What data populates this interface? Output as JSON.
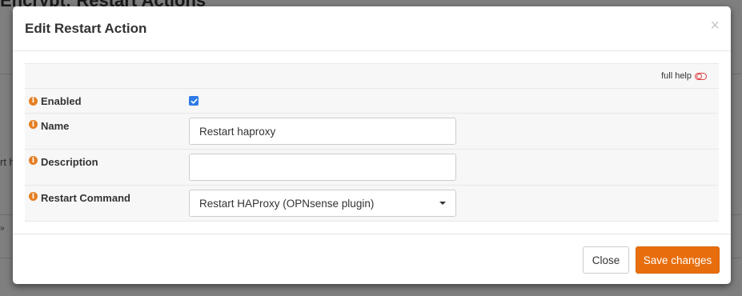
{
  "background": {
    "title_fragment": "Encrypt: Restart Actions",
    "fragment_1": "rt h",
    "fragment_2": "»"
  },
  "modal": {
    "title": "Edit Restart Action",
    "close_glyph": "×",
    "full_help_label": "full help",
    "fields": {
      "enabled": {
        "label": "Enabled",
        "checked": true
      },
      "name": {
        "label": "Name",
        "value": "Restart haproxy"
      },
      "description": {
        "label": "Description",
        "value": ""
      },
      "restart_command": {
        "label": "Restart Command",
        "value": "Restart HAProxy (OPNsense plugin)"
      }
    },
    "footer": {
      "close_label": "Close",
      "save_label": "Save changes"
    }
  },
  "colors": {
    "accent": "#e86e0d",
    "info_icon": "#e67e22",
    "checkbox": "#2e7ae6",
    "help_toggle": "#e04040"
  },
  "icons": {
    "info": "info-circle-icon",
    "help_toggle": "toggle-off-icon",
    "close": "close-icon",
    "dropdown": "caret-down-icon"
  }
}
